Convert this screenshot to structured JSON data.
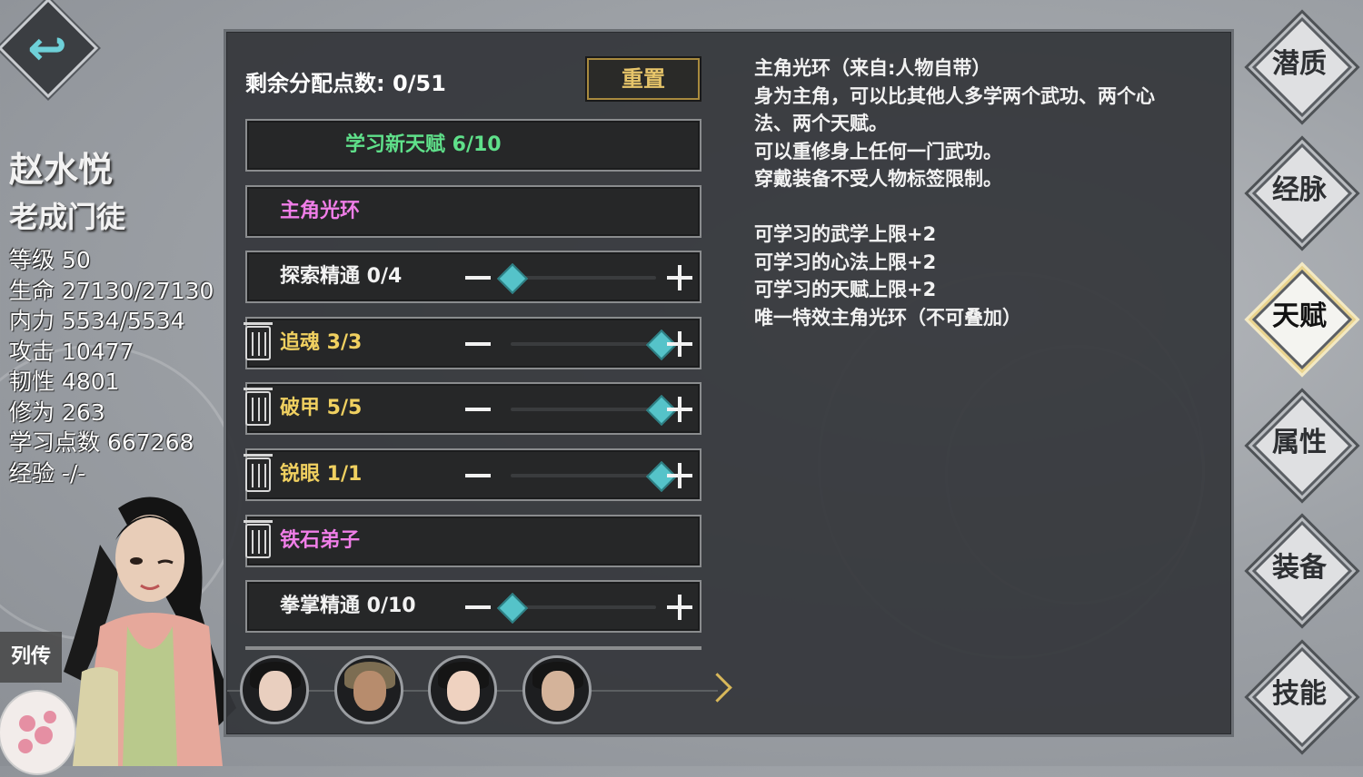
{
  "character": {
    "name": "赵水悦",
    "title": "老成门徒",
    "stats": [
      "等级 50",
      "生命 27130/27130",
      "内力 5534/5534",
      "攻击 10477",
      "韧性 4801",
      "修为 263",
      "学习点数 667268",
      "经验 -/-"
    ],
    "biography_label": "列传"
  },
  "talents": {
    "remaining_points_label": "剩余分配点数: 0/51",
    "reset_label": "重置",
    "learn_new_label": "学习新天赋 6/10",
    "rows": [
      {
        "label": "主角光环",
        "color": "#f07ee8",
        "deletable": false,
        "slider": false
      },
      {
        "label": "探索精通 0/4",
        "color": "#f2f2f2",
        "deletable": false,
        "slider": true,
        "level": 0,
        "max": 4
      },
      {
        "label": "追魂 3/3",
        "color": "#f0d060",
        "deletable": true,
        "slider": true,
        "level": 3,
        "max": 3
      },
      {
        "label": "破甲 5/5",
        "color": "#f0d060",
        "deletable": true,
        "slider": true,
        "level": 5,
        "max": 5
      },
      {
        "label": "锐眼 1/1",
        "color": "#f0d060",
        "deletable": true,
        "slider": true,
        "level": 1,
        "max": 1
      },
      {
        "label": "铁石弟子",
        "color": "#f07ee8",
        "deletable": true,
        "slider": false
      },
      {
        "label": "拳掌精通 0/10",
        "color": "#f2f2f2",
        "deletable": false,
        "slider": true,
        "level": 0,
        "max": 10
      }
    ]
  },
  "description": {
    "lines": [
      "主角光环（来自:人物自带）",
      "身为主角，可以比其他人多学两个武功、两个心",
      "法、两个天赋。",
      "可以重修身上任何一门武功。",
      "穿戴装备不受人物标签限制。",
      "",
      "可学习的武学上限+2",
      "可学习的心法上限+2",
      "可学习的天赋上限+2",
      "唯一特效主角光环（不可叠加）"
    ]
  },
  "nav": {
    "items": [
      "潜质",
      "经脉",
      "天赋",
      "属性",
      "装备",
      "技能"
    ],
    "active": "天赋"
  },
  "colors": {
    "accent_teal": "#55c3c9",
    "talent_gold": "#f0d060",
    "talent_pink": "#f07ee8",
    "learn_green": "#5fe08a",
    "reset_gold": "#e7c56a"
  },
  "party_avatars": [
    "party-member-1",
    "party-member-2",
    "party-member-3",
    "party-member-4"
  ]
}
